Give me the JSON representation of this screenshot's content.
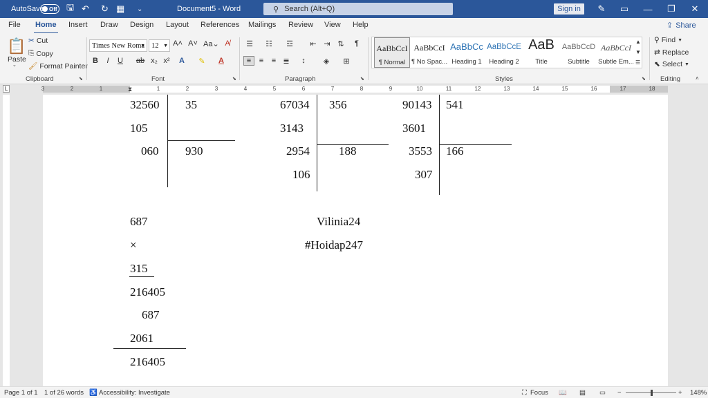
{
  "titlebar": {
    "autosave_label": "AutoSave",
    "autosave_state": "Off",
    "doc_title": "Document5 - Word",
    "search_placeholder": "Search (Alt+Q)",
    "signin_label": "Sign in",
    "accent_color": "#2b579a"
  },
  "tabs": [
    "File",
    "Home",
    "Insert",
    "Draw",
    "Design",
    "Layout",
    "References",
    "Mailings",
    "Review",
    "View",
    "Help"
  ],
  "active_tab": "Home",
  "share_label": "Share",
  "ribbon": {
    "clipboard": {
      "paste": "Paste",
      "cut": "Cut",
      "copy": "Copy",
      "format_painter": "Format Painter",
      "group": "Clipboard"
    },
    "font": {
      "font_name": "Times New Roma",
      "font_size": "12",
      "group": "Font"
    },
    "paragraph": {
      "group": "Paragraph"
    },
    "styles": {
      "group": "Styles",
      "items": [
        {
          "preview": "AaBbCcI",
          "name": "¶ Normal"
        },
        {
          "preview": "AaBbCcI",
          "name": "¶ No Spac..."
        },
        {
          "preview": "AaBbCc",
          "name": "Heading 1"
        },
        {
          "preview": "AaBbCcE",
          "name": "Heading 2"
        },
        {
          "preview": "AaB",
          "name": "Title"
        },
        {
          "preview": "AaBbCcD",
          "name": "Subtitle"
        },
        {
          "preview": "AaBbCcI",
          "name": "Subtle Em..."
        }
      ]
    },
    "editing": {
      "find": "Find",
      "replace": "Replace",
      "select": "Select",
      "group": "Editing"
    }
  },
  "ruler": {
    "numbers": [
      "3",
      "2",
      "1",
      "1",
      "2",
      "3",
      "4",
      "5",
      "6",
      "7",
      "8",
      "9",
      "10",
      "11",
      "12",
      "13",
      "14",
      "15",
      "16",
      "17",
      "18"
    ]
  },
  "document": {
    "division1": {
      "dividend": "32560",
      "divisor": "35",
      "step1": "105",
      "remainder": "060",
      "quotient": "930"
    },
    "division2": {
      "dividend": "67034",
      "divisor": "356",
      "step1": "3143",
      "step2": "2954",
      "remainder": "106",
      "quotient": "188"
    },
    "division3": {
      "dividend": "90143",
      "divisor": "541",
      "step1": "3601",
      "step2": "3553",
      "remainder": "307",
      "quotient": "166"
    },
    "multiplication": {
      "multiplicand": "687",
      "operator": "×",
      "multiplier": "315",
      "partial1": "216405",
      "partial2": "687",
      "partial3": "2061",
      "result": "216405"
    },
    "signature": {
      "name": "Vilinia24",
      "tag": "#Hoidap247"
    }
  },
  "status": {
    "page": "Page 1 of 1",
    "words": "1 of 26 words",
    "accessibility": "Accessibility: Investigate",
    "focus": "Focus",
    "zoom": "148%"
  }
}
